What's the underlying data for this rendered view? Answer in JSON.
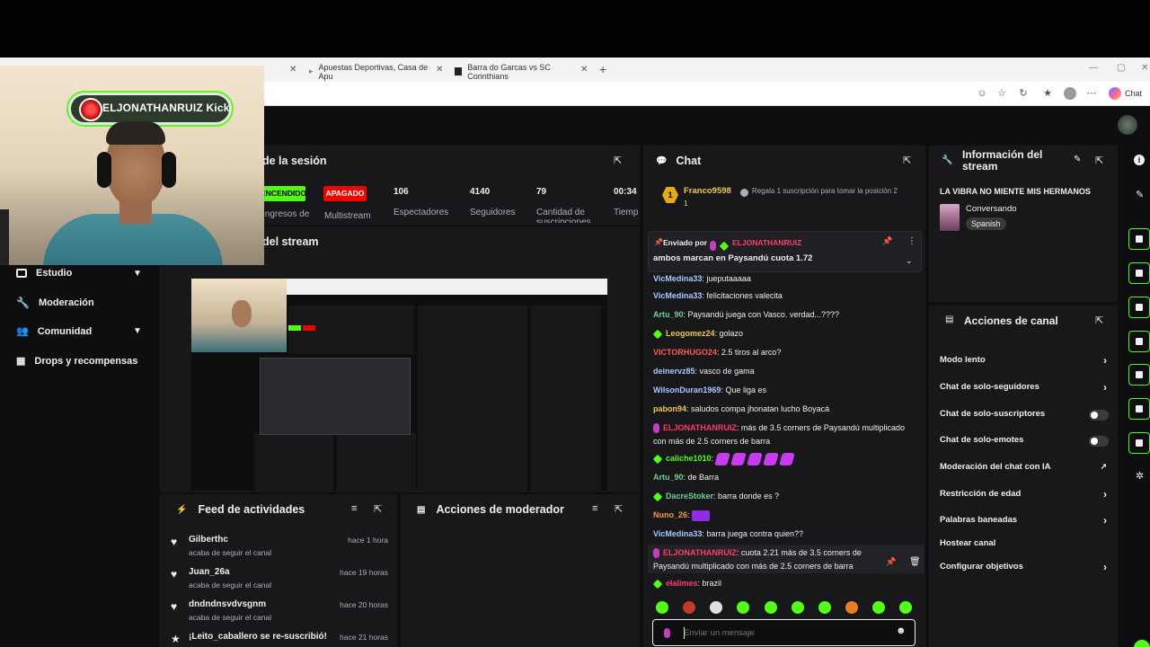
{
  "browser": {
    "tabs": [
      {
        "label": "Apuestas Deportivas, Casa de Apu"
      },
      {
        "label": "Barra do Garcas vs SC Corinthians"
      }
    ],
    "copilot_label": "Chat"
  },
  "webcam": {
    "overlay_text": "ELJONATHANRUIZ Kick"
  },
  "sidebar": {
    "items": [
      {
        "label": "Estudio"
      },
      {
        "label": "Moderación"
      },
      {
        "label": "Comunidad"
      },
      {
        "label": "Drops y recompensas"
      }
    ]
  },
  "session": {
    "title": "de la sesión",
    "status_on": "ENCENDIDO",
    "status_off": "APAGADO",
    "stats": [
      {
        "value": "",
        "label": "Ingresos de"
      },
      {
        "value": "",
        "label": "Multistream"
      },
      {
        "value": "106",
        "label": "Espectadores"
      },
      {
        "value": "4140",
        "label": "Seguidores"
      },
      {
        "value": "79",
        "label": "Cantidad de suscripciones"
      },
      {
        "value": "00:34",
        "label": "Tiemp"
      }
    ]
  },
  "stream_preview": {
    "title": "del stream"
  },
  "activity_feed": {
    "title": "Feed de actividades",
    "items": [
      {
        "name": "Gilberthc",
        "sub": "acaba de seguir el canal",
        "time": "hace 1 hora"
      },
      {
        "name": "Juan_26a",
        "sub": "acaba de seguir el canal",
        "time": "hace 19 horas"
      },
      {
        "name": "dndndnsvdvsgnm",
        "sub": "acaba de seguir el canal",
        "time": "hace 20 horas"
      },
      {
        "name": "¡Leito_caballero se re-suscribió!",
        "sub": "",
        "time": "hace 21 horas"
      }
    ]
  },
  "mod_actions": {
    "title": "Acciones de moderador"
  },
  "chat": {
    "title": "Chat",
    "top_user": "Franco9598",
    "top_user_count": "1",
    "top_rank": "1",
    "gift_text": "Regala 1 suscripción para tomar la posición 2",
    "pinned_by_label": "Enviado por",
    "pinned_user": "ELJONATHANRUIZ",
    "pinned_message": "ambos marcan en Paysandú cuota 1.72",
    "messages": [
      {
        "user": "VicMedina33",
        "text": "jueputaaaaa",
        "color": "#a8c8ff"
      },
      {
        "user": "VicMedina33",
        "text": "felicitaciones valecita",
        "color": "#a8c8ff"
      },
      {
        "user": "Artu_90",
        "text": "Paysandú juega con Vasco. verdad...????",
        "color": "#6fcf97"
      },
      {
        "user": "Leogomez24",
        "text": "golazo",
        "color": "#f2c94c"
      },
      {
        "user": "VICTORHUGO24",
        "text": "2.5 tiros al arco?",
        "color": "#ff5a5a"
      },
      {
        "user": "deinervz85",
        "text": "vasco de gama",
        "color": "#a8c8ff"
      },
      {
        "user": "WilsonDuran1969",
        "text": "Que liga es",
        "color": "#a8c8ff"
      },
      {
        "user": "pabon94",
        "text": "saludos compa jhonatan lucho Boyacá",
        "color": "#f2c94c"
      },
      {
        "user": "ELJONATHANRUIZ",
        "text": "más de 3.5 corners de Paysandú multiplicado con más de 2.5 corners de barra",
        "color": "#ff3b6b"
      },
      {
        "user": "caliche1010",
        "text": "",
        "color": "#53fc18"
      },
      {
        "user": "Artu_90",
        "text": "de Barra",
        "color": "#6fcf97"
      },
      {
        "user": "DacreStoker",
        "text": "barra donde es ?",
        "color": "#6fcf97"
      },
      {
        "user": "Nuno_26",
        "text": "",
        "color": "#f2994a"
      },
      {
        "user": "VicMedina33",
        "text": "barra juega contra quien??",
        "color": "#a8c8ff"
      },
      {
        "user": "ELJONATHANRUIZ",
        "text": "cuota 2.21 más de 3.5 corners de Paysandú multiplicado con más de 2.5 corners de barra",
        "color": "#ff3b6b"
      },
      {
        "user": "elalimes",
        "text": "brazil",
        "color": "#ff3b6b"
      }
    ],
    "input_placeholder": "Enviar un mensaje"
  },
  "stream_info": {
    "title": "Información del stream",
    "stream_title": "LA VIBRA NO MIENTE MIS HERMANOS",
    "category": "Conversando",
    "language": "Spanish"
  },
  "channel_actions": {
    "title": "Acciones de canal",
    "items": [
      {
        "label": "Modo lento",
        "control": "chevron"
      },
      {
        "label": "Chat de solo-seguidores",
        "control": "chevron"
      },
      {
        "label": "Chat de solo-suscriptores",
        "control": "toggle"
      },
      {
        "label": "Chat de solo-emotes",
        "control": "toggle"
      },
      {
        "label": "Moderación del chat con IA",
        "control": "external"
      },
      {
        "label": "Restricción de edad",
        "control": "chevron"
      },
      {
        "label": "Palabras baneadas",
        "control": "chevron"
      },
      {
        "label": "Hostear canal",
        "control": "none"
      },
      {
        "label": "Configurar objetivos",
        "control": "chevron"
      }
    ]
  },
  "colors": {
    "accent": "#53fc18",
    "panel": "#18181b",
    "background": "#0e0e10",
    "status_on": "#53fc18",
    "status_off": "#eb0400"
  }
}
